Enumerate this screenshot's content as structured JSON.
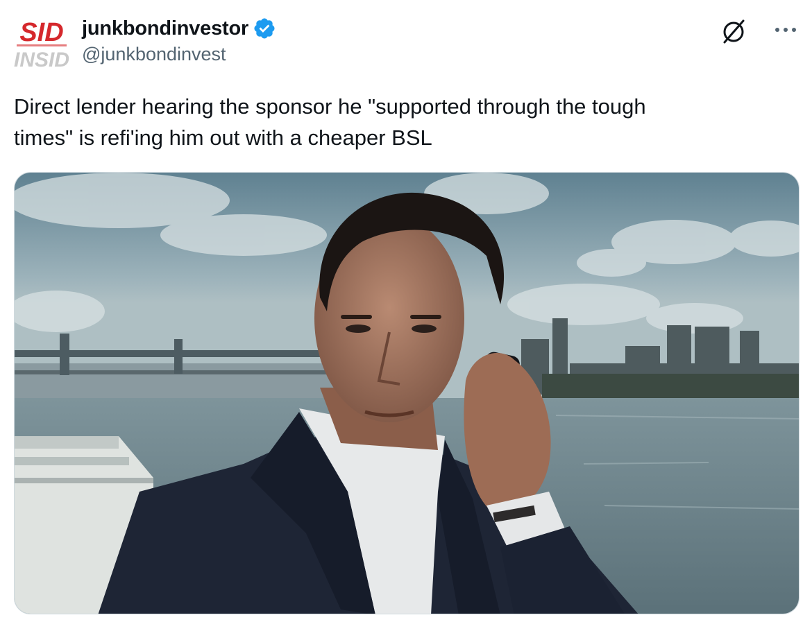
{
  "author": {
    "display_name": "junkbondinvestor",
    "handle": "@junkbondinvest",
    "verified": true,
    "avatar_text_top": "SID",
    "avatar_text_bottom": "INSID"
  },
  "actions": {
    "grok_icon": "grok-icon",
    "more_icon": "more-icon",
    "more_label": "···"
  },
  "tweet": {
    "text": "Direct lender hearing the sponsor he \"supported through the tough\ntimes\" is refi'ing him out with a cheaper BSL"
  },
  "media": {
    "type": "photo",
    "alt": "Man in a navy suit on a phone call by a river with a bridge and skyline behind him"
  },
  "colors": {
    "text": "#0f1419",
    "secondary": "#536471",
    "verified": "#1d9bf0",
    "border": "#cfd9de",
    "avatar_red": "#d5282c"
  }
}
